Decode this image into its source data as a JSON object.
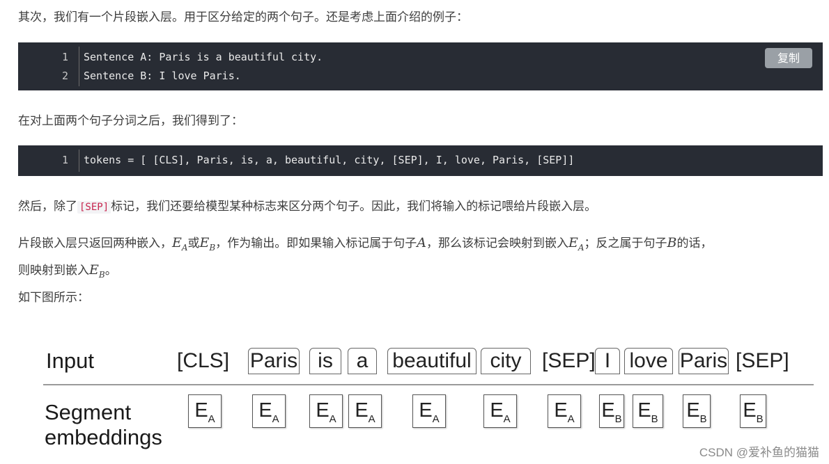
{
  "paragraphs": {
    "p1": "其次，我们有一个片段嵌入层。用于区分给定的两个句子。还是考虑上面介绍的例子：",
    "p2": "在对上面两个句子分词之后，我们得到了：",
    "p3_before": "然后，除了",
    "p3_code": "[SEP]",
    "p3_after": "标记，我们还要给模型某种标志来区分两个句子。因此，我们将输入的标记喂给片段嵌入层。",
    "p4_a": "片段嵌入层只返回两种嵌入，",
    "p4_b": "或",
    "p4_c": "，作为输出。即如果输入标记属于句子",
    "p4_d": "，那么该标记会映射到嵌入",
    "p4_e": "；反之属于句子",
    "p4_f": "的话，",
    "p4_g": "则映射到嵌入",
    "p4_h": "。",
    "p5": "如下图所示："
  },
  "math": {
    "E": "E",
    "A": "A",
    "B": "B"
  },
  "code_block_1": {
    "copy_label": "复制",
    "lines": [
      {
        "num": "1",
        "text": "Sentence A: Paris is a beautiful city."
      },
      {
        "num": "2",
        "text": "Sentence B: I love Paris."
      }
    ]
  },
  "code_block_2": {
    "lines": [
      {
        "num": "1",
        "text": "tokens = [ [CLS], Paris, is, a, beautiful, city, [SEP], I, love, Paris, [SEP]]"
      }
    ]
  },
  "figure": {
    "input_label": "Input",
    "segment_label_1": "Segment",
    "segment_label_2": "embeddings",
    "tokens": [
      "[CLS]",
      "Paris",
      "is",
      "a",
      "beautiful",
      "city",
      "[SEP]",
      "I",
      "love",
      "Paris",
      "[SEP]"
    ],
    "embeddings": [
      {
        "E": "E",
        "sub": "A"
      },
      {
        "E": "E",
        "sub": "A"
      },
      {
        "E": "E",
        "sub": "A"
      },
      {
        "E": "E",
        "sub": "A"
      },
      {
        "E": "E",
        "sub": "A"
      },
      {
        "E": "E",
        "sub": "A"
      },
      {
        "E": "E",
        "sub": "A"
      },
      {
        "E": "E",
        "sub": "B"
      },
      {
        "E": "E",
        "sub": "B"
      },
      {
        "E": "E",
        "sub": "B"
      },
      {
        "E": "E",
        "sub": "B"
      }
    ]
  },
  "watermark": "CSDN @爱补鱼的猫猫"
}
